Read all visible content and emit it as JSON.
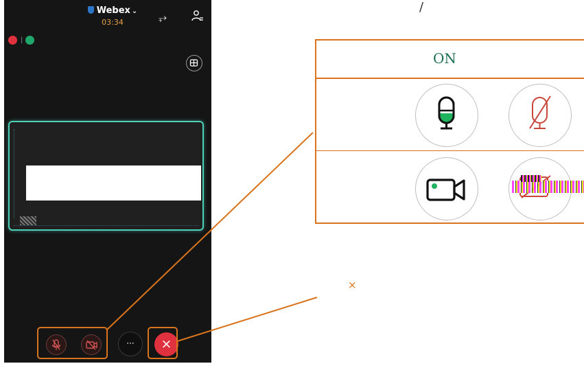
{
  "app": {
    "title": "Webex",
    "timer": "03:34"
  },
  "controls": {
    "more_label": "···",
    "end_label": "×"
  },
  "legend": {
    "header": "ON"
  },
  "annotations": {
    "slash": "/",
    "cross": "×"
  },
  "colors": {
    "accent_orange": "#d9741d",
    "tile_border": "#4ecfb8",
    "end_call_red": "#e0323e",
    "mic_on_green": "#1fb35e",
    "off_red": "#c8453a",
    "timer_orange": "#e7a248",
    "header_text": "#1d6f53"
  },
  "icons": [
    "shield-icon",
    "chevron-down-icon",
    "bluetooth-icon",
    "participants-icon",
    "recording-indicator-icon",
    "signal-indicator-icon",
    "layout-grid-icon",
    "mute-icon",
    "camera-off-icon",
    "more-icon",
    "end-call-icon",
    "microphone-icon",
    "microphone-off-icon",
    "camera-icon"
  ]
}
